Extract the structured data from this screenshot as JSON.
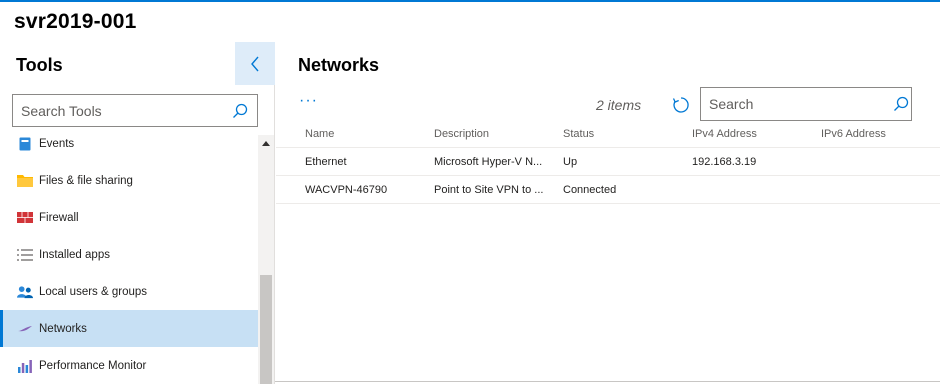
{
  "app": {
    "server_name": "svr2019-001",
    "accent": "#0078d4"
  },
  "tools": {
    "title": "Tools",
    "collapse_icon": "chevron-left-icon",
    "search_placeholder": "Search Tools",
    "items": [
      {
        "label": "Events",
        "icon": "events-icon"
      },
      {
        "label": "Files & file sharing",
        "icon": "folder-icon"
      },
      {
        "label": "Firewall",
        "icon": "firewall-icon"
      },
      {
        "label": "Installed apps",
        "icon": "list-icon"
      },
      {
        "label": "Local users & groups",
        "icon": "users-icon"
      },
      {
        "label": "Networks",
        "icon": "network-icon",
        "selected": true
      },
      {
        "label": "Performance Monitor",
        "icon": "chart-icon"
      }
    ]
  },
  "main": {
    "title": "Networks",
    "more_label": "···",
    "item_count": "2 items",
    "search_placeholder": "Search",
    "columns": [
      "Name",
      "Description",
      "Status",
      "IPv4 Address",
      "IPv6 Address"
    ],
    "rows": [
      [
        "Ethernet",
        "Microsoft Hyper-V N...",
        "Up",
        "192.168.3.19",
        ""
      ],
      [
        "WACVPN-46790",
        "Point to Site VPN to ...",
        "Connected",
        "",
        ""
      ]
    ]
  }
}
